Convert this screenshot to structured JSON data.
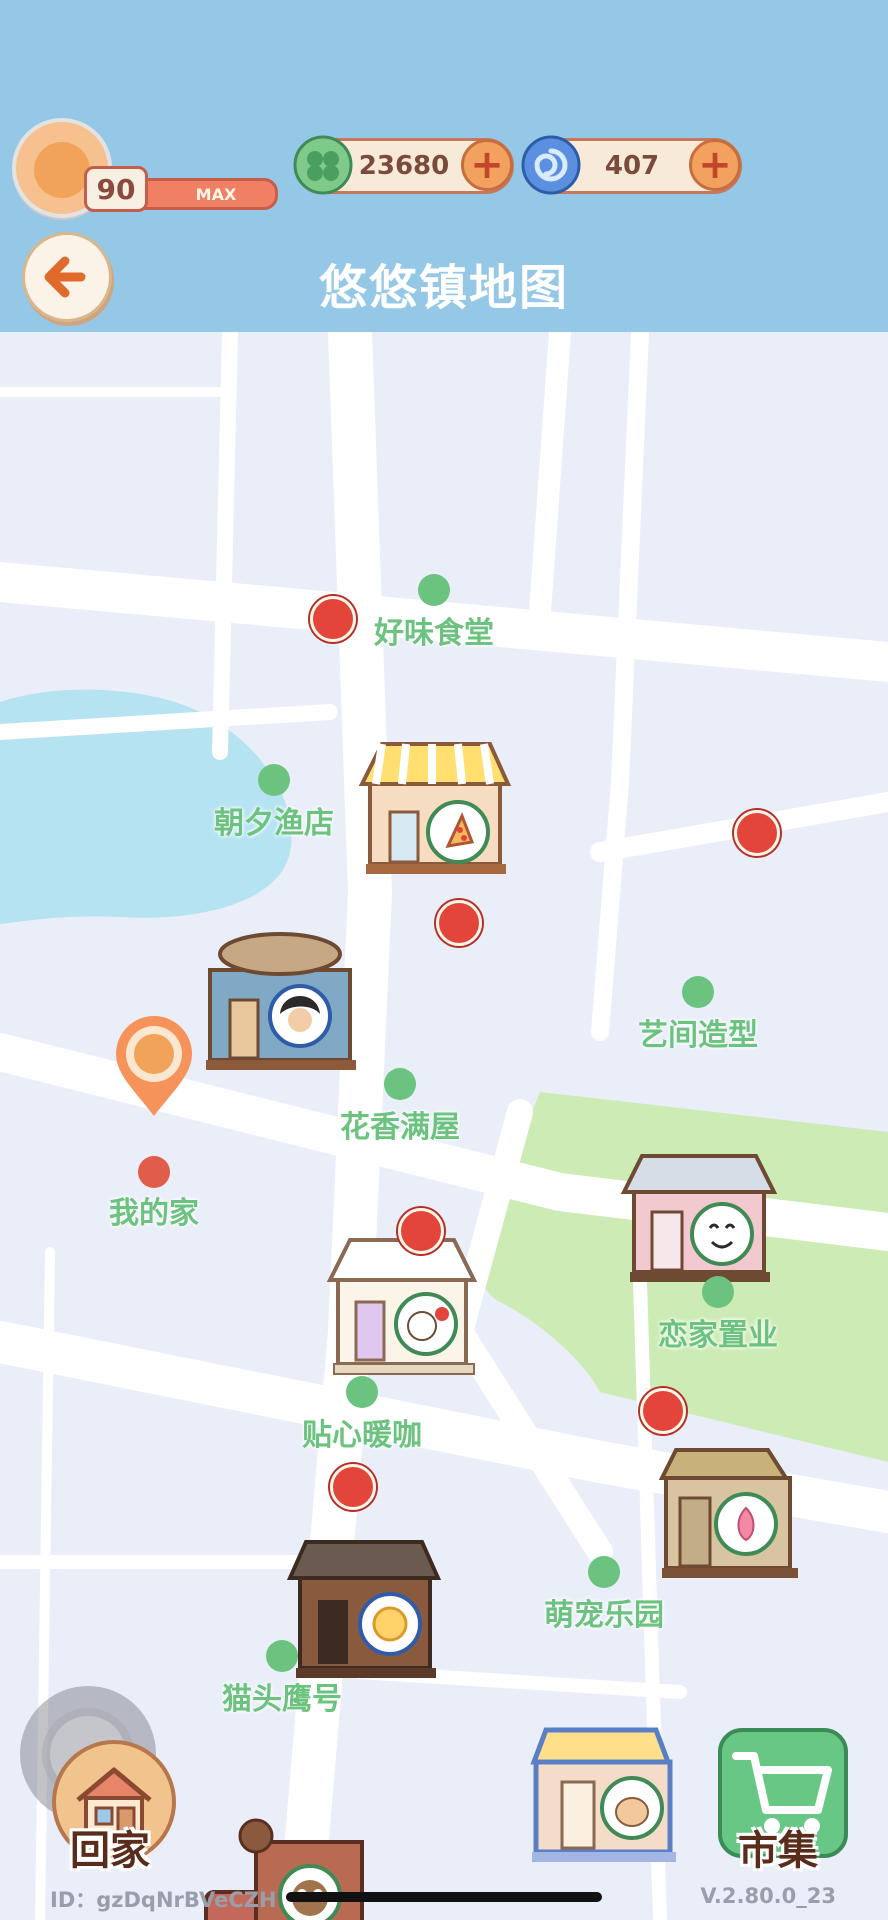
{
  "header": {
    "title": "悠悠镇地图",
    "level": "90",
    "level_status": "MAX",
    "currency_clover": "23680",
    "currency_swirl": "407",
    "back_icon": "arrow-left-icon"
  },
  "shops": [
    {
      "key": "haowei",
      "name": "好味食堂",
      "icon": "pizza-icon",
      "has_badge": false
    },
    {
      "key": "zhaoxi",
      "name": "朝夕渔店",
      "icon": "fisherman-icon",
      "has_badge": true
    },
    {
      "key": "yijian",
      "name": "艺间造型",
      "icon": "stylist-icon",
      "has_badge": true
    },
    {
      "key": "huaxiang",
      "name": "花香满屋",
      "icon": "flower-cat-icon",
      "has_badge": true
    },
    {
      "key": "lianjia",
      "name": "恋家置业",
      "icon": "lotus-icon",
      "has_badge": false
    },
    {
      "key": "tiexin",
      "name": "贴心暖咖",
      "icon": "sun-cafe-icon",
      "has_badge": true
    },
    {
      "key": "mengchong",
      "name": "萌宠乐园",
      "icon": "pet-cat-icon",
      "has_badge": true
    },
    {
      "key": "maotouying",
      "name": "猫头鹰号",
      "icon": "owl-icon",
      "has_badge": true
    }
  ],
  "home_marker": {
    "name": "我的家"
  },
  "footer": {
    "home_button": "回家",
    "market_button": "市集",
    "player_id": "ID：gzDqNrBVeCZH",
    "version": "V.2.80.0_23"
  },
  "colors": {
    "header_bg": "#94c8e6",
    "map_bg": "#e9eef9",
    "road": "#ffffff",
    "lake": "#b6e3f1",
    "park": "#cdebb5",
    "label_green": "#6cc37f",
    "badge_red": "#e4453a"
  }
}
